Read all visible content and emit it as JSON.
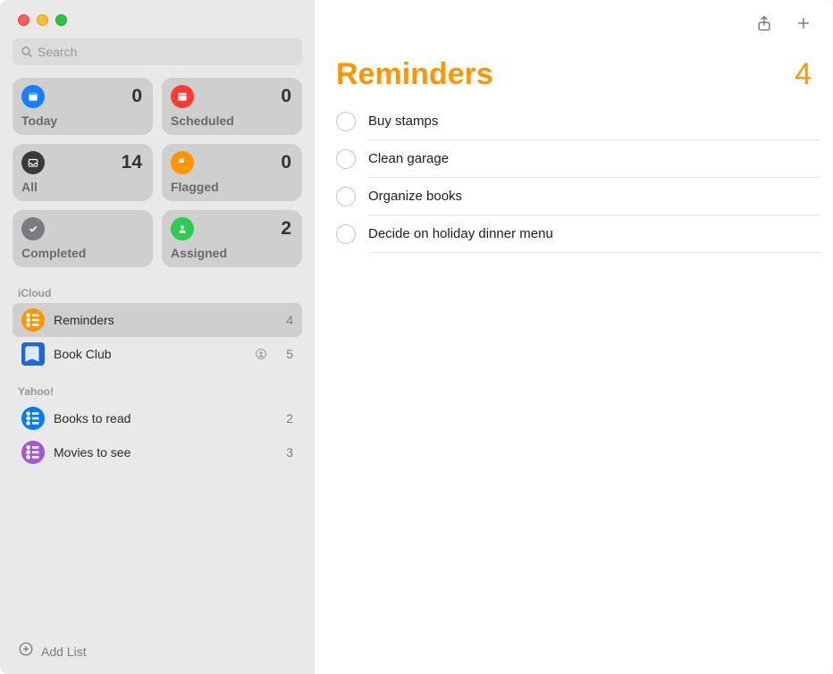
{
  "search": {
    "placeholder": "Search"
  },
  "smartLists": [
    {
      "id": "today",
      "label": "Today",
      "count": 0,
      "bg": "#177fff"
    },
    {
      "id": "scheduled",
      "label": "Scheduled",
      "count": 0,
      "bg": "#ff3b30"
    },
    {
      "id": "all",
      "label": "All",
      "count": 14,
      "bg": "#3a3a3c"
    },
    {
      "id": "flagged",
      "label": "Flagged",
      "count": 0,
      "bg": "#ff9500"
    },
    {
      "id": "completed",
      "label": "Completed",
      "count": "",
      "bg": "#7c7c80"
    },
    {
      "id": "assigned",
      "label": "Assigned",
      "count": 2,
      "bg": "#2dcb4f"
    }
  ],
  "sections": [
    {
      "name": "iCloud",
      "lists": [
        {
          "name": "Reminders",
          "count": 4,
          "color": "#ff9500",
          "selected": true,
          "shared": false,
          "iconStyle": "bullet"
        },
        {
          "name": "Book Club",
          "count": 5,
          "color": "#1f66d6",
          "selected": false,
          "shared": true,
          "iconStyle": "book"
        }
      ]
    },
    {
      "name": "Yahoo!",
      "lists": [
        {
          "name": "Books to read",
          "count": 2,
          "color": "#007aff",
          "selected": false,
          "shared": false,
          "iconStyle": "bullet"
        },
        {
          "name": "Movies to see",
          "count": 3,
          "color": "#a357d7",
          "selected": false,
          "shared": false,
          "iconStyle": "bullet"
        }
      ]
    }
  ],
  "addList": {
    "label": "Add List"
  },
  "currentList": {
    "title": "Reminders",
    "count": 4,
    "items": [
      {
        "title": "Buy stamps"
      },
      {
        "title": "Clean garage"
      },
      {
        "title": "Organize books"
      },
      {
        "title": "Decide on holiday dinner menu"
      }
    ]
  }
}
